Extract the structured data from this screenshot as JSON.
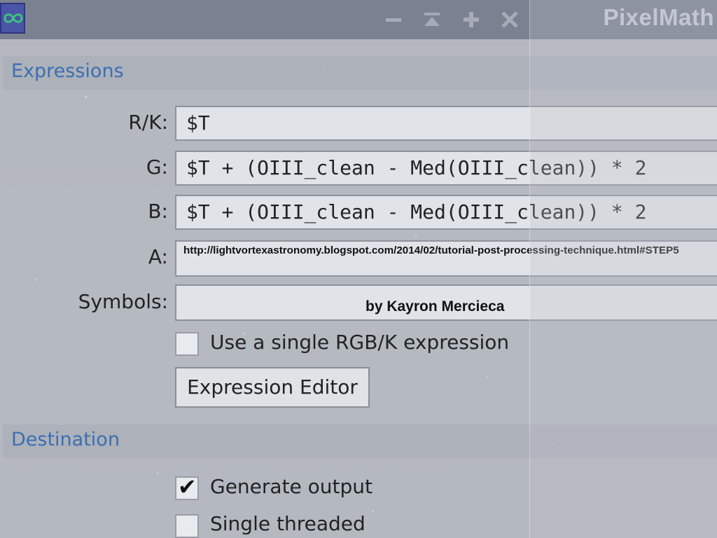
{
  "window": {
    "title": "PixelMath",
    "controls": {
      "minimize": "minimize-icon",
      "shade": "shade-icon",
      "maximize": "plus-icon",
      "close": "close-icon"
    }
  },
  "expressions": {
    "header": "Expressions",
    "rk_label": "R/K:",
    "rk_value": "$T",
    "g_label": "G:",
    "g_value": "$T + (OIII_clean - Med(OIII_clean)) * 2",
    "b_label": "B:",
    "b_value": "$T + (OIII_clean - Med(OIII_clean)) * 2",
    "a_label": "A:",
    "a_value": "http://lightvortexastronomy.blogspot.com/2014/02/tutorial-post-processing-technique.html#STEP5",
    "symbols_label": "Symbols:",
    "symbols_value": "by Kayron Mercieca",
    "single_rgb_label": "Use a single RGB/K expression",
    "single_rgb_checked": false,
    "editor_button": "Expression Editor"
  },
  "destination": {
    "header": "Destination",
    "generate_output_label": "Generate output",
    "generate_output_checked": true,
    "single_threaded_label": "Single threaded",
    "single_threaded_checked": false
  },
  "colors": {
    "section_header_text": "#3c6fb0",
    "titlebar": "#7c8192",
    "app_icon": "#4a55a8"
  }
}
